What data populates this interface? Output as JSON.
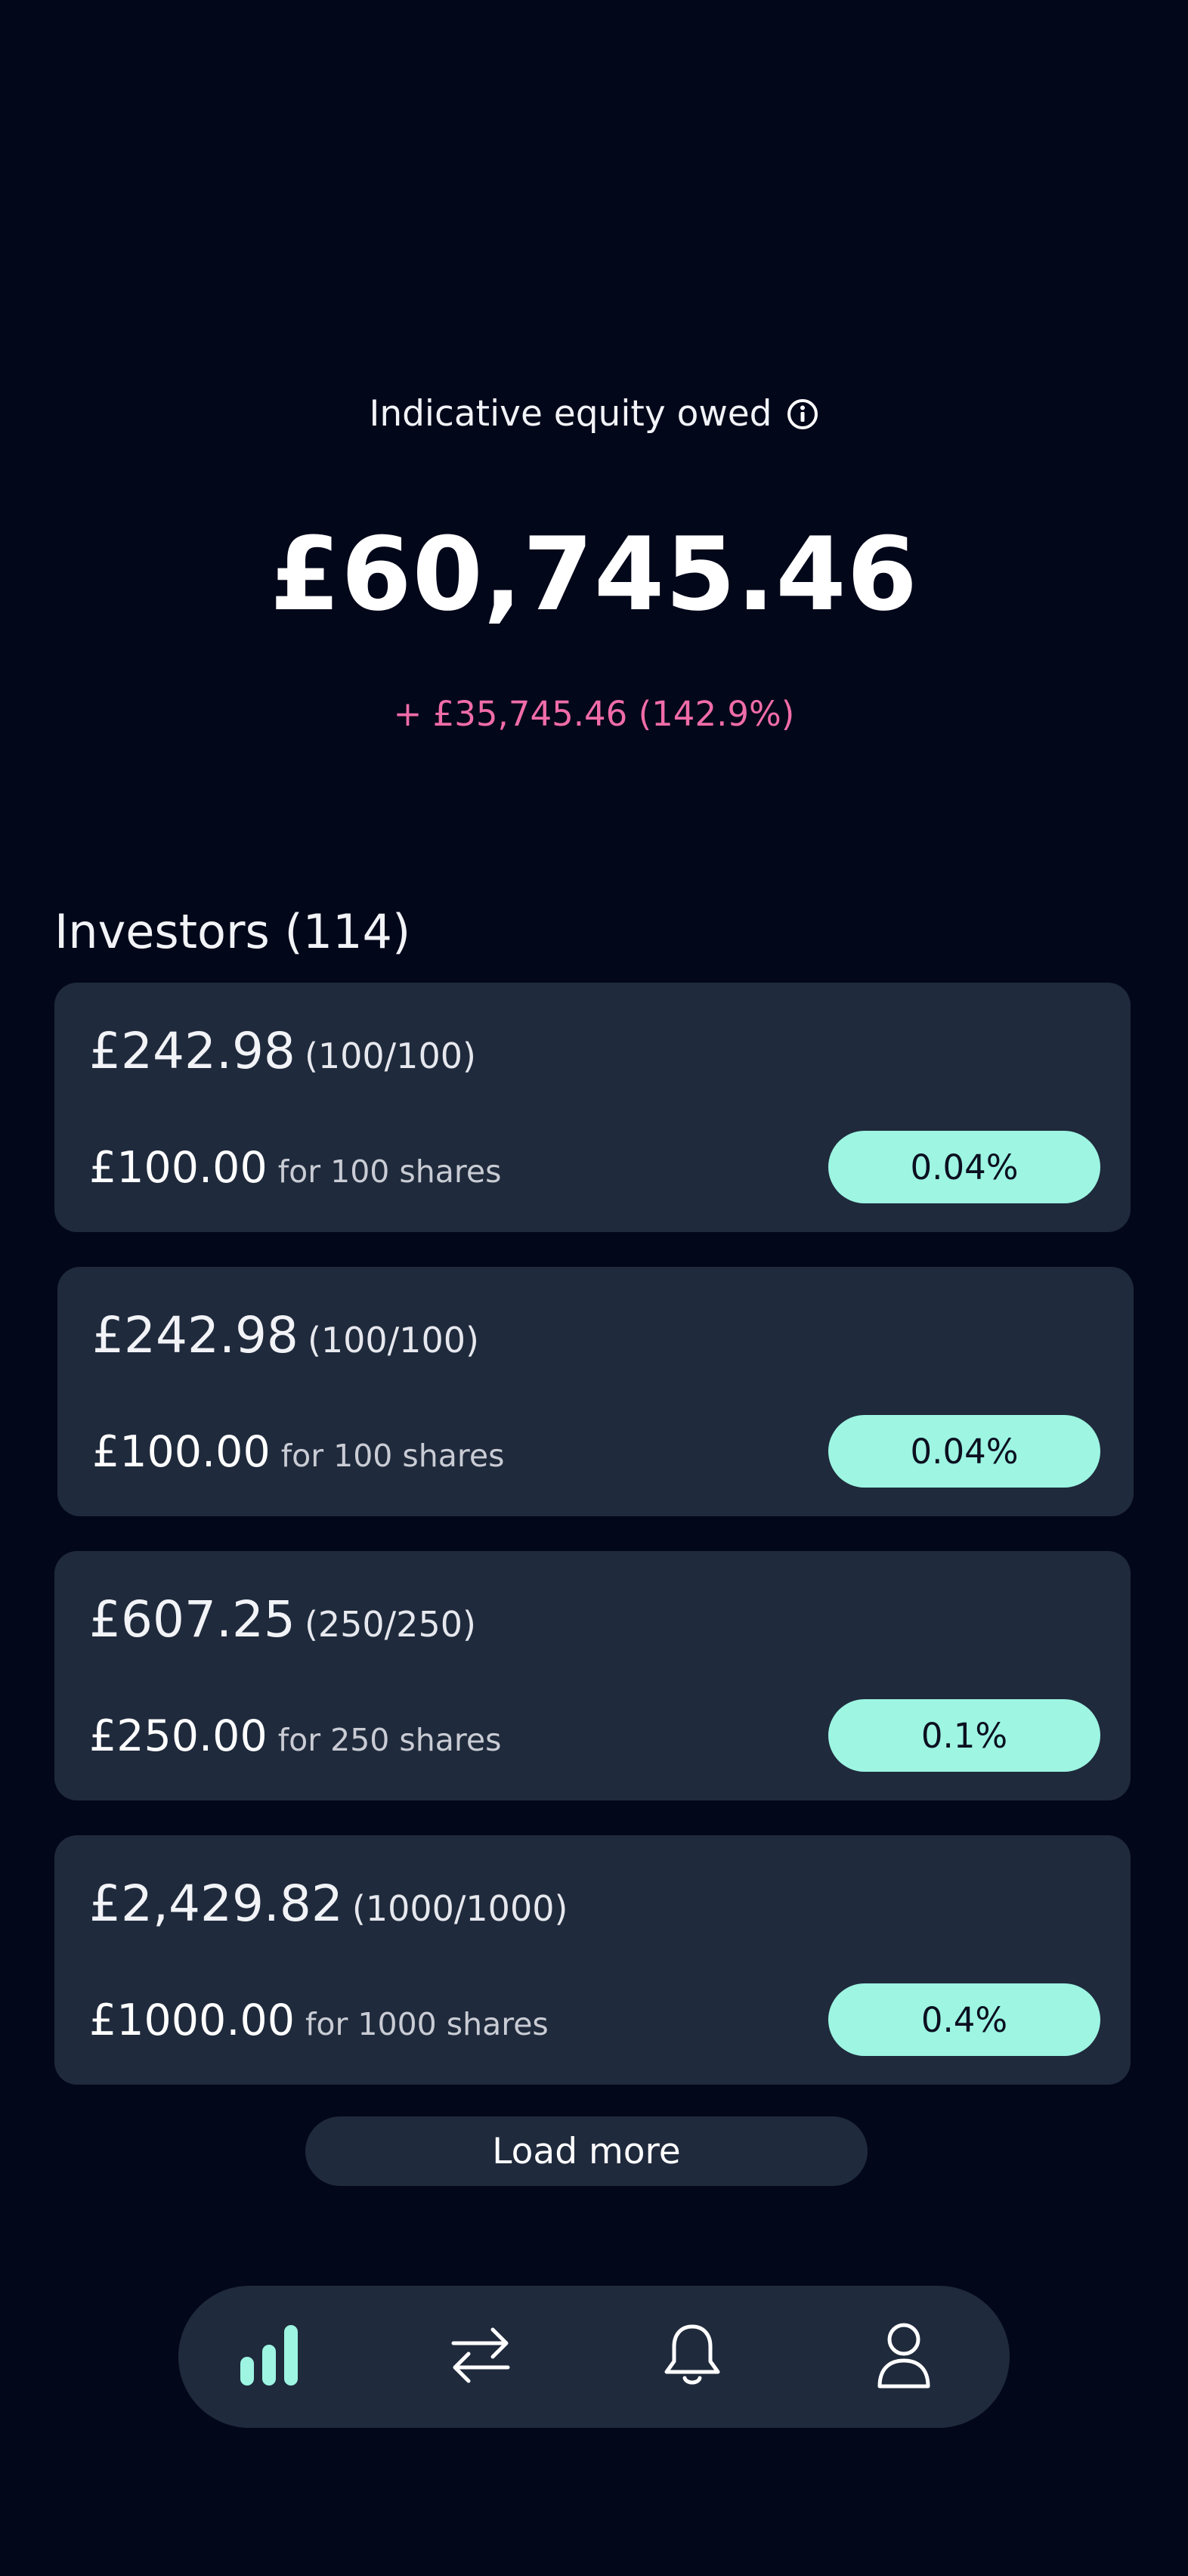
{
  "summary": {
    "label": "Indicative equity owed",
    "info_icon": "info-icon",
    "amount": "£60,745.46",
    "change": "+ £35,745.46 (142.9%)",
    "change_color": "#f06ca8"
  },
  "investors": {
    "title": "Investors (114)",
    "items": [
      {
        "value": "£242.98",
        "ratio": "(100/100)",
        "paid": "£100.00",
        "shares": "for 100 shares",
        "percent": "0.04%"
      },
      {
        "value": "£242.98",
        "ratio": "(100/100)",
        "paid": "£100.00",
        "shares": "for 100 shares",
        "percent": "0.04%"
      },
      {
        "value": "£607.25",
        "ratio": "(250/250)",
        "paid": "£250.00",
        "shares": "for 250 shares",
        "percent": "0.1%"
      },
      {
        "value": "£2,429.82",
        "ratio": "(1000/1000)",
        "paid": "£1000.00",
        "shares": "for 1000 shares",
        "percent": "0.4%"
      }
    ],
    "load_more_label": "Load more"
  },
  "nav": {
    "items": [
      {
        "icon": "bar-chart-icon",
        "active": true
      },
      {
        "icon": "transfer-arrows-icon",
        "active": false
      },
      {
        "icon": "bell-icon",
        "active": false
      },
      {
        "icon": "user-icon",
        "active": false
      }
    ]
  },
  "colors": {
    "background": "#03071a",
    "card": "#1f2a3c",
    "accent": "#9df5e2",
    "negative_change": "#f06ca8"
  }
}
